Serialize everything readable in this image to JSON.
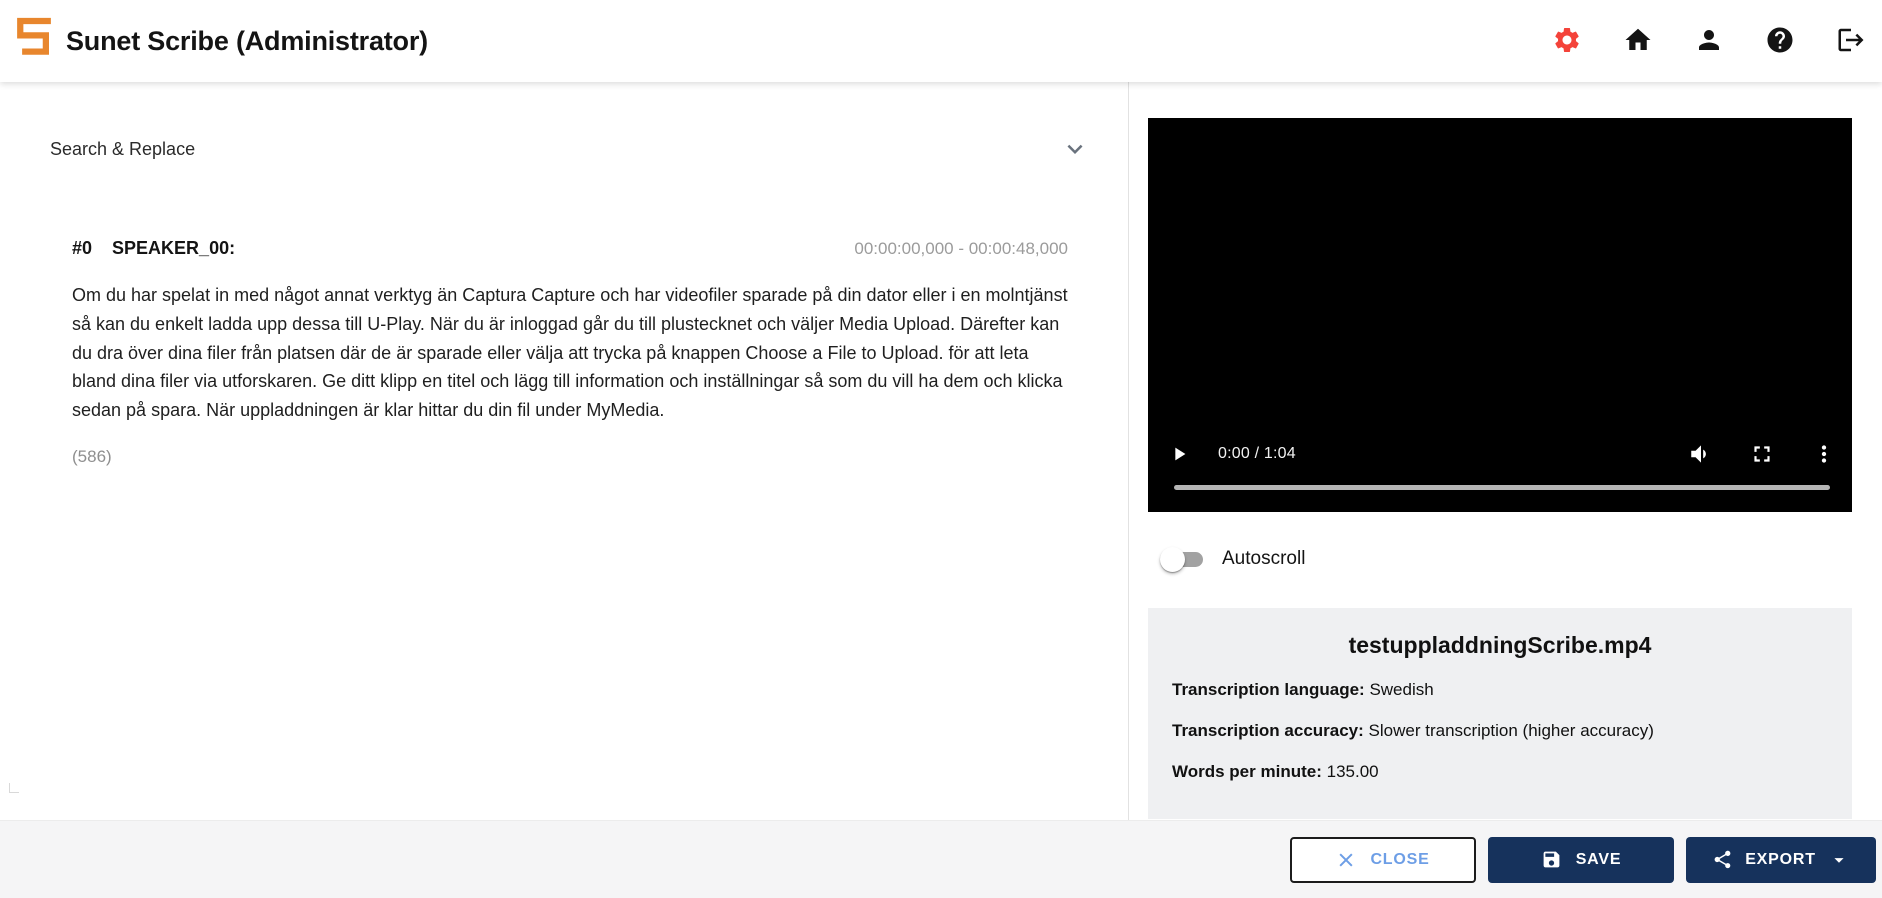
{
  "header": {
    "title": "Sunet Scribe (Administrator)"
  },
  "search_replace": {
    "label": "Search & Replace"
  },
  "transcript": {
    "segments": [
      {
        "index": "#0",
        "speaker": "SPEAKER_00:",
        "time_range": "00:00:00,000 - 00:00:48,000",
        "text": "Om du har spelat in med något annat verktyg än Captura Capture och har videofiler sparade på din dator eller i en molntjänst så kan du enkelt ladda upp dessa till U-Play. När du är inloggad går du till plustecknet och väljer Media Upload. Därefter kan du dra över dina filer från platsen där de är sparade eller välja att trycka på knappen Choose a File to Upload. för att leta bland dina filer via utforskaren. Ge ditt klipp en titel och lägg till information och inställningar så som du vill ha dem och klicka sedan på spara. När uppladdningen är klar hittar du din fil under MyMedia.",
        "char_count": "(586)"
      }
    ]
  },
  "video_player": {
    "time_display": "0:00 / 1:04"
  },
  "autoscroll": {
    "label": "Autoscroll",
    "enabled": false
  },
  "media_info": {
    "filename": "testuppladdningScribe.mp4",
    "fields": [
      {
        "label": "Transcription language:",
        "value": "Swedish"
      },
      {
        "label": "Transcription accuracy:",
        "value": "Slower transcription (higher accuracy)"
      },
      {
        "label": "Words per minute:",
        "value": "135.00"
      }
    ]
  },
  "footer": {
    "close": "CLOSE",
    "save": "SAVE",
    "export": "EXPORT"
  },
  "colors": {
    "logo_orange": "#e8862d",
    "settings_red": "#f4433a",
    "button_navy": "#16325c",
    "close_blue": "#6d9ee6",
    "timestamp_gray": "#9b9b9b"
  }
}
